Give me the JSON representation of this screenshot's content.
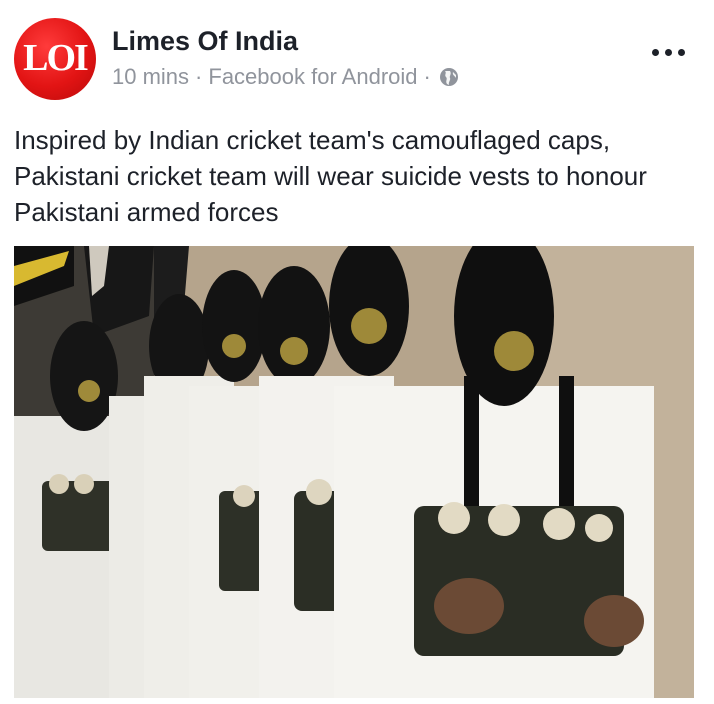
{
  "post": {
    "author": {
      "avatar_text": "LOI",
      "name": "Limes Of India"
    },
    "meta": {
      "time": "10 mins",
      "separator": "·",
      "source": "Facebook for Android",
      "audience_icon": "globe-icon"
    },
    "more_icon": "more-horizontal-icon",
    "text": "Inspired by Indian cricket team's camouflaged caps, Pakistani cricket team will wear suicide vests to honour Pakistani armed forces",
    "image": {
      "alt_subject": "photo"
    }
  },
  "colors": {
    "avatar_red": "#e21414",
    "text_primary": "#1d2129",
    "text_secondary": "#90949c"
  }
}
